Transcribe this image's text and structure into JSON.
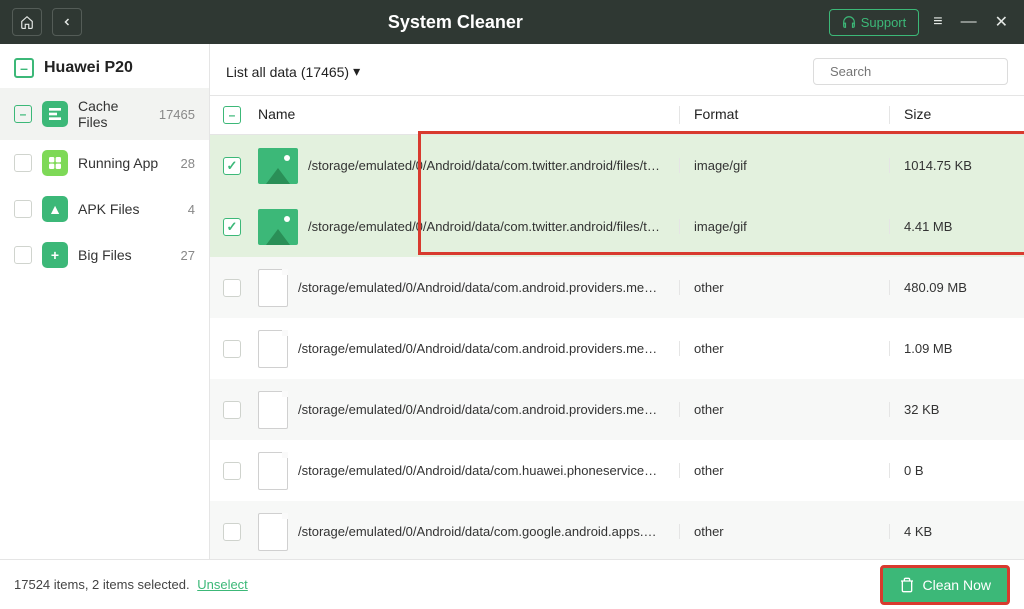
{
  "header": {
    "title": "System Cleaner",
    "support": "Support"
  },
  "device": "Huawei P20",
  "sidebar": {
    "items": [
      {
        "label": "Cache Files",
        "count": "17465"
      },
      {
        "label": "Running App",
        "count": "28"
      },
      {
        "label": "APK Files",
        "count": "4"
      },
      {
        "label": "Big Files",
        "count": "27"
      }
    ]
  },
  "filter": {
    "prefix": "List all data",
    "count": "(17465)"
  },
  "search": {
    "placeholder": "Search"
  },
  "columns": {
    "name": "Name",
    "format": "Format",
    "size": "Size"
  },
  "rows": [
    {
      "path": "/storage/emulated/0/Android/data/com.twitter.android/files/tmp...",
      "format": "image/gif",
      "size": "1014.75 KB",
      "selected": true,
      "type": "image",
      "alt": false
    },
    {
      "path": "/storage/emulated/0/Android/data/com.twitter.android/files/tmp...",
      "format": "image/gif",
      "size": "4.41 MB",
      "selected": true,
      "type": "image",
      "alt": false
    },
    {
      "path": "/storage/emulated/0/Android/data/com.android.providers.media...",
      "format": "other",
      "size": "480.09 MB",
      "selected": false,
      "type": "file",
      "alt": true
    },
    {
      "path": "/storage/emulated/0/Android/data/com.android.providers.media...",
      "format": "other",
      "size": "1.09 MB",
      "selected": false,
      "type": "file",
      "alt": false
    },
    {
      "path": "/storage/emulated/0/Android/data/com.android.providers.media...",
      "format": "other",
      "size": "32 KB",
      "selected": false,
      "type": "file",
      "alt": true
    },
    {
      "path": "/storage/emulated/0/Android/data/com.huawei.phoneservice/ca...",
      "format": "other",
      "size": "0 B",
      "selected": false,
      "type": "file",
      "alt": false
    },
    {
      "path": "/storage/emulated/0/Android/data/com.google.android.apps.ma...",
      "format": "other",
      "size": "4 KB",
      "selected": false,
      "type": "file",
      "alt": true
    }
  ],
  "footer": {
    "status": "17524 items, 2 items selected.",
    "unselect": "Unselect",
    "clean": "Clean Now"
  }
}
